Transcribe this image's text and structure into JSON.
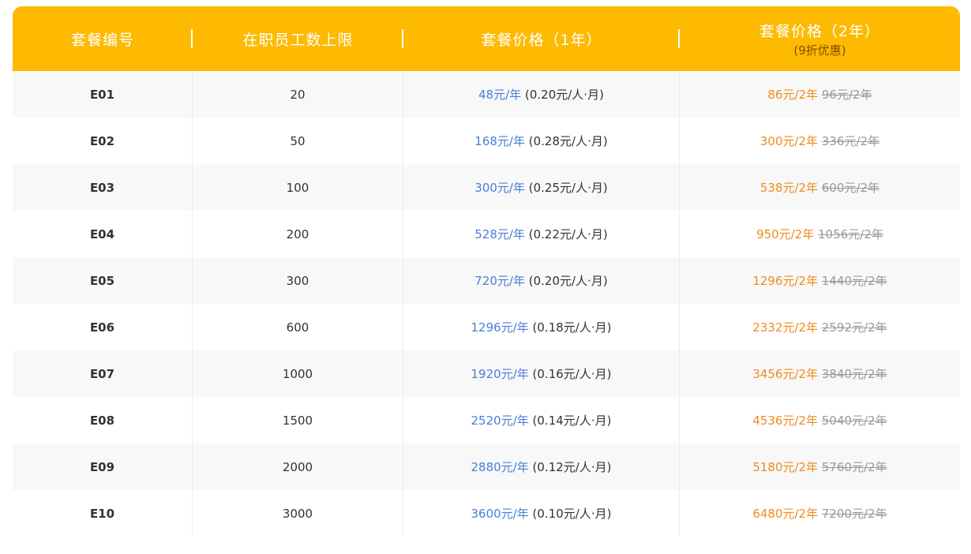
{
  "header": {
    "col1": "套餐编号",
    "col2": "在职员工数上限",
    "col3": "套餐价格（1年）",
    "col4": "套餐价格（2年）",
    "col4_sub": "(9折优惠)"
  },
  "colors": {
    "header_bg": "#FDBA00",
    "price_1y": "#4a7fd6",
    "price_2y": "#f08a1c",
    "price_original": "#999999"
  },
  "rows": [
    {
      "code": "E01",
      "limit": "20",
      "price1": "48元/年",
      "unit": "(0.20元/人·月)",
      "price2": "86元/2年",
      "original": "96元/2年"
    },
    {
      "code": "E02",
      "limit": "50",
      "price1": "168元/年",
      "unit": "(0.28元/人·月)",
      "price2": "300元/2年",
      "original": "336元/2年"
    },
    {
      "code": "E03",
      "limit": "100",
      "price1": "300元/年",
      "unit": "(0.25元/人·月)",
      "price2": "538元/2年",
      "original": "600元/2年"
    },
    {
      "code": "E04",
      "limit": "200",
      "price1": "528元/年",
      "unit": "(0.22元/人·月)",
      "price2": "950元/2年",
      "original": "1056元/2年"
    },
    {
      "code": "E05",
      "limit": "300",
      "price1": "720元/年",
      "unit": "(0.20元/人·月)",
      "price2": "1296元/2年",
      "original": "1440元/2年"
    },
    {
      "code": "E06",
      "limit": "600",
      "price1": "1296元/年",
      "unit": "(0.18元/人·月)",
      "price2": "2332元/2年",
      "original": "2592元/2年"
    },
    {
      "code": "E07",
      "limit": "1000",
      "price1": "1920元/年",
      "unit": "(0.16元/人·月)",
      "price2": "3456元/2年",
      "original": "3840元/2年"
    },
    {
      "code": "E08",
      "limit": "1500",
      "price1": "2520元/年",
      "unit": "(0.14元/人·月)",
      "price2": "4536元/2年",
      "original": "5040元/2年"
    },
    {
      "code": "E09",
      "limit": "2000",
      "price1": "2880元/年",
      "unit": "(0.12元/人·月)",
      "price2": "5180元/2年",
      "original": "5760元/2年"
    },
    {
      "code": "E10",
      "limit": "3000",
      "price1": "3600元/年",
      "unit": "(0.10元/人·月)",
      "price2": "6480元/2年",
      "original": "7200元/2年"
    }
  ]
}
